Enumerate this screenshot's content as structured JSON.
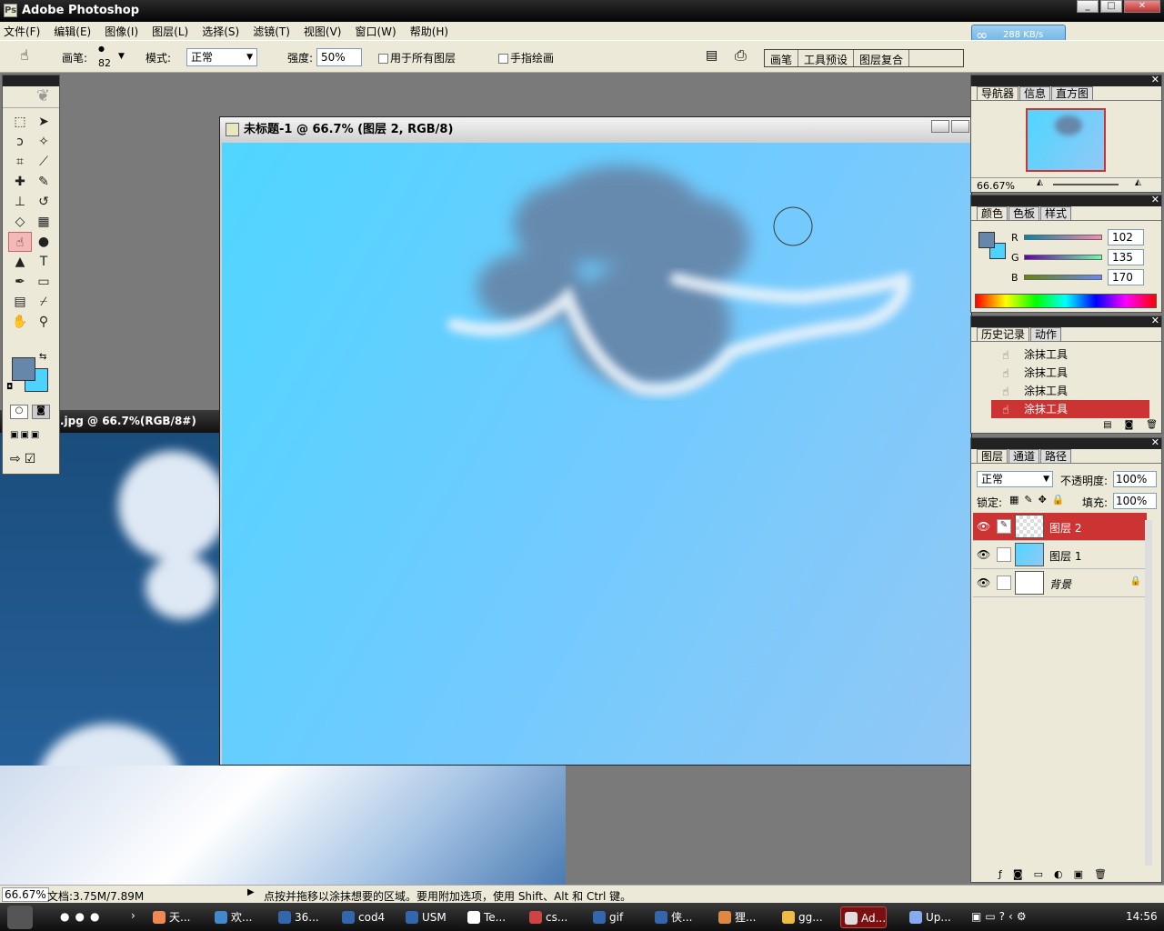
{
  "app_title": "Adobe Photoshop",
  "menu": [
    "文件(F)",
    "编辑(E)",
    "图像(I)",
    "图层(L)",
    "选择(S)",
    "滤镜(T)",
    "视图(V)",
    "窗口(W)",
    "帮助(H)"
  ],
  "net_speed": "288 KB/s",
  "options": {
    "brush_label": "画笔:",
    "brush_size": "82",
    "mode_label": "模式:",
    "mode_value": "正常",
    "strength_label": "强度:",
    "strength_value": "50%",
    "all_layers": "用于所有图层",
    "finger_paint": "手指绘画"
  },
  "dock_tabs": [
    "画笔",
    "工具预设",
    "图层复合"
  ],
  "doc1": {
    "title": "未标题-1 @ 66.7% (图层 2, RGB/8)"
  },
  "doc2": {
    "title": ".jpg @ 66.7%(RGB/8#)"
  },
  "navigator": {
    "tabs": [
      "导航器",
      "信息",
      "直方图"
    ],
    "zoom": "66.67%"
  },
  "color_panel": {
    "tabs": [
      "颜色",
      "色板",
      "样式"
    ],
    "r_label": "R",
    "g_label": "G",
    "b_label": "B",
    "r": "102",
    "g": "135",
    "b": "170",
    "fg": "#6687aa",
    "bg": "#4ed2ff"
  },
  "history": {
    "tabs": [
      "历史记录",
      "动作"
    ],
    "items": [
      "涂抹工具",
      "涂抹工具",
      "涂抹工具",
      "涂抹工具"
    ]
  },
  "layers": {
    "tabs": [
      "图层",
      "通道",
      "路径"
    ],
    "blend": "正常",
    "opacity_label": "不透明度:",
    "opacity": "100%",
    "lock_label": "锁定:",
    "fill_label": "填充:",
    "fill": "100%",
    "rows": [
      {
        "name": "图层 2"
      },
      {
        "name": "图层 1"
      },
      {
        "name": "背景"
      }
    ]
  },
  "status": {
    "zoom": "66.67%",
    "doc": "文档:3.75M/7.89M",
    "hint": "点按并拖移以涂抹想要的区域。要用附加选项，使用 Shift、Alt 和 Ctrl 键。"
  },
  "taskbar": {
    "items": [
      "天...",
      "欢...",
      "36...",
      "cod4",
      "USM",
      "Te...",
      "cs...",
      "gif",
      "侠...",
      "狸...",
      "gg...",
      "Ad...",
      "Up..."
    ],
    "clock": "14:56"
  }
}
